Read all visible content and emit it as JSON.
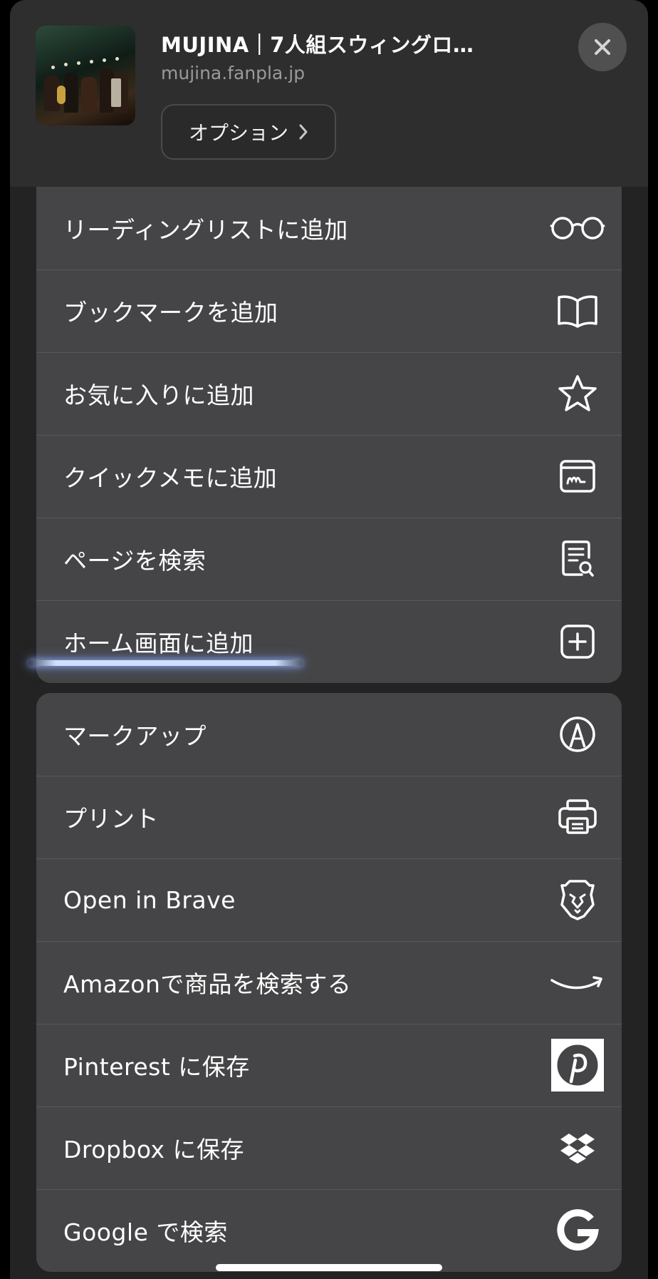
{
  "header": {
    "title": "MUJINA｜7人組スウィングロ…",
    "domain": "mujina.fanpla.jp",
    "options_label": "オプション",
    "options_chevron": "chevron-right-icon",
    "close": "close-icon"
  },
  "group1": [
    {
      "label": "リーディングリストに追加",
      "icon": "glasses-icon"
    },
    {
      "label": "ブックマークを追加",
      "icon": "book-icon"
    },
    {
      "label": "お気に入りに追加",
      "icon": "star-icon"
    },
    {
      "label": "クイックメモに追加",
      "icon": "quick-note-icon"
    },
    {
      "label": "ページを検索",
      "icon": "doc-search-icon"
    },
    {
      "label": "ホーム画面に追加",
      "icon": "add-square-icon"
    }
  ],
  "group2": [
    {
      "label": "マークアップ",
      "icon": "markup-icon"
    },
    {
      "label": "プリント",
      "icon": "printer-icon"
    },
    {
      "label": "Open in Brave",
      "icon": "brave-lion-icon"
    },
    {
      "label": "Amazonで商品を検索する",
      "icon": "amazon-smile-icon"
    },
    {
      "label": "Pinterest に保存",
      "icon": "pinterest-icon"
    },
    {
      "label": "Dropbox に保存",
      "icon": "dropbox-icon"
    },
    {
      "label": "Google で検索",
      "icon": "google-icon"
    }
  ],
  "colors": {
    "sheet_bg": "#232323",
    "group_bg": "#454547",
    "separator": "#58585a",
    "annotation": "#cfe0ff"
  }
}
